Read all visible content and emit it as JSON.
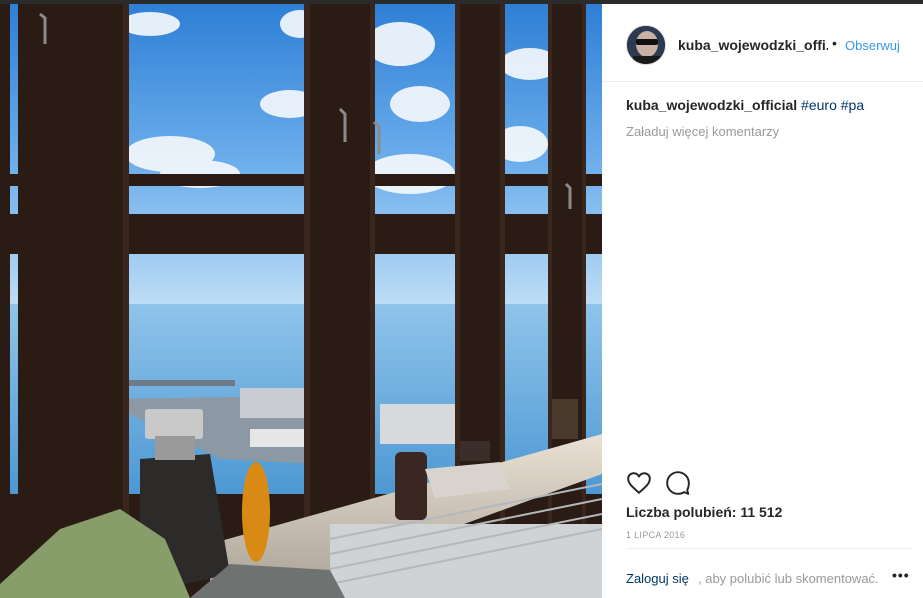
{
  "post": {
    "username": "kuba_wojewodzki_offi...",
    "separator": "•",
    "follow_label": "Obserwuj",
    "caption": {
      "username": "kuba_wojewodzki_official",
      "tags": [
        "#euro",
        "#pa"
      ]
    },
    "load_more_label": "Załaduj więcej komentarzy",
    "likes": "Liczba polubień: 11 512",
    "date": "1 LIPCA 2016",
    "footer": {
      "login_label": "Zaloguj się",
      "login_text": ", aby polubić lub skomentować.",
      "more_label": "•••"
    },
    "icons": {
      "like": "heart-icon",
      "comment": "comment-icon"
    },
    "colors": {
      "link_blue": "#3897f0",
      "tag_blue": "#003569",
      "muted": "#999999"
    }
  }
}
